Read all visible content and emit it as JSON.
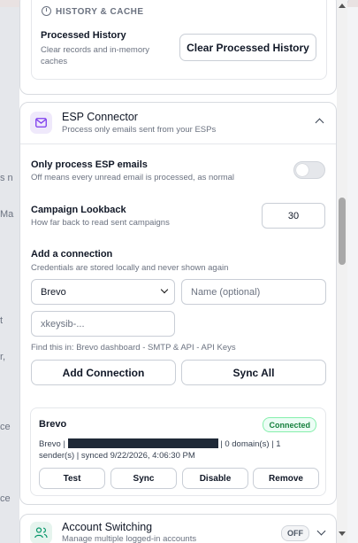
{
  "background": {
    "fragments": [
      "s n",
      "Ma",
      "t",
      "r,",
      "ce",
      "ce"
    ]
  },
  "history": {
    "section_label": "HISTORY & CACHE",
    "title": "Processed History",
    "description": "Clear records and in-memory caches",
    "clear_button": "Clear Processed History"
  },
  "esp": {
    "title": "ESP Connector",
    "subtitle": "Process only emails sent from your ESPs",
    "only_esp": {
      "title": "Only process ESP emails",
      "description": "Off means every unread email is processed, as normal",
      "enabled": false
    },
    "lookback": {
      "title": "Campaign Lookback",
      "description": "How far back to read sent campaigns",
      "value": "30"
    },
    "add_connection": {
      "title": "Add a connection",
      "description": "Credentials are stored locally and never shown again",
      "provider_selected": "Brevo",
      "name_placeholder": "Name (optional)",
      "key_placeholder": "xkeysib-...",
      "hint": "Find this in: Brevo dashboard - SMTP & API - API Keys",
      "add_button": "Add Connection",
      "sync_all_button": "Sync All"
    },
    "connection": {
      "name": "Brevo",
      "status": "Connected",
      "meta_prefix": "Brevo |",
      "meta_suffix": "| 0 domain(s) | 1 sender(s) | synced 9/22/2026, 4:06:30 PM",
      "buttons": {
        "test": "Test",
        "sync": "Sync",
        "disable": "Disable",
        "remove": "Remove"
      }
    }
  },
  "account_switching": {
    "title": "Account Switching",
    "subtitle": "Manage multiple logged-in accounts",
    "status": "OFF"
  },
  "colors": {
    "accent_purple": "#efe9fb",
    "connected_green": "#15803d"
  }
}
